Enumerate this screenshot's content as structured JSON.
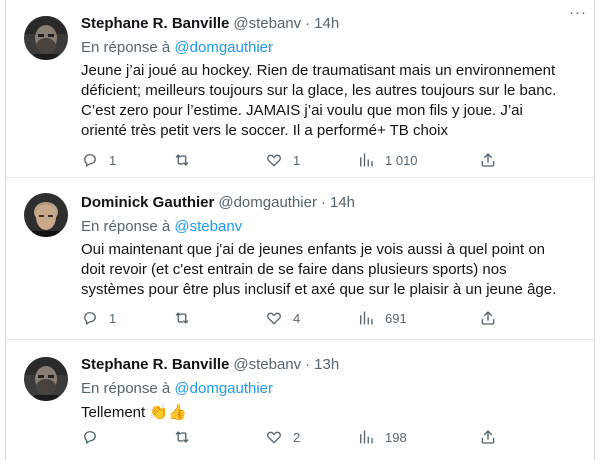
{
  "tweets": [
    {
      "author_name": "Stephane R. Banville",
      "handle": "@stebanv",
      "separator": "·",
      "time": "14h",
      "reply_prefix": "En réponse à",
      "reply_to": "@domgauthier",
      "text": "Jeune j’ai joué au hockey. Rien de traumatisant mais un environnement déficient; meilleurs toujours sur la glace, les autres toujours sur le banc. C’est zero pour l’estime. JAMAIS j’ai voulu que mon fils y joue. J’ai orienté très petit vers le soccer. Il a performé+ TB choix",
      "emoji": "",
      "replies": "1",
      "retweets": "",
      "likes": "1",
      "views": "1 010"
    },
    {
      "author_name": "Dominick Gauthier",
      "handle": "@domgauthier",
      "separator": "·",
      "time": "14h",
      "reply_prefix": "En réponse à",
      "reply_to": "@stebanv",
      "text": "Oui maintenant que j'ai de jeunes enfants je vois aussi à quel point on doit revoir (et c'est entrain de se faire dans plusieurs sports) nos systèmes pour être plus inclusif et axé que sur le plaisir à un jeune âge.",
      "emoji": "",
      "replies": "1",
      "retweets": "",
      "likes": "4",
      "views": "691"
    },
    {
      "author_name": "Stephane R. Banville",
      "handle": "@stebanv",
      "separator": "·",
      "time": "13h",
      "reply_prefix": "En réponse à",
      "reply_to": "@domgauthier",
      "text": "Tellement",
      "emoji": "👏👍",
      "replies": "",
      "retweets": "",
      "likes": "2",
      "views": "198"
    }
  ],
  "more_label": "···",
  "icons": {
    "reply": "reply-icon",
    "retweet": "retweet-icon",
    "like": "heart-icon",
    "views": "views-icon",
    "share": "share-icon",
    "more": "more-icon"
  },
  "colors": {
    "text": "#0f1419",
    "secondary": "#536471",
    "link": "#1d9bf0",
    "divider": "#dfe5e8"
  }
}
